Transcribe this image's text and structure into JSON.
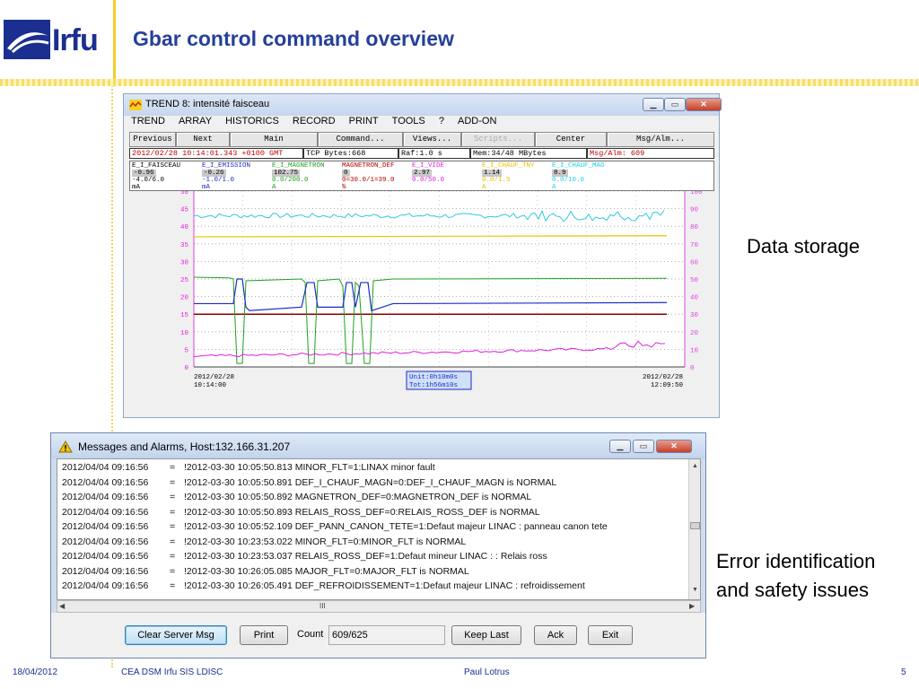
{
  "slide": {
    "title": "Gbar control command overview",
    "logo_text": "Irfu",
    "caption_data": "Data storage",
    "caption_error_line1": "Error identification",
    "caption_error_line2": "and safety issues",
    "footer_date": "18/04/2012",
    "footer_org": "CEA DSM Irfu SIS LDISC",
    "footer_author": "Paul Lotrus",
    "footer_page": "5"
  },
  "trend": {
    "title": "TREND 8: intensité faisceau",
    "menu": [
      "TREND",
      "ARRAY",
      "HISTORICS",
      "RECORD",
      "PRINT",
      "TOOLS",
      "?",
      "ADD-ON"
    ],
    "buttons": [
      "Previous",
      "Next",
      "Main",
      "Command...",
      "Views...",
      "Scripts...",
      "Center",
      "Msg/Alm..."
    ],
    "status": {
      "time": "2012/02/28 10:14:01.343 +0100 GMT",
      "tcp": "TCP Bytes:668",
      "raf": "Raf:1.0 s",
      "mem": "Mem:34/48 MBytes",
      "msg": "Msg/Alm: 609"
    },
    "params": [
      {
        "name": "E_I_FAISCEAU",
        "value": "-0.96",
        "range": "-4.0/6.0",
        "unit": "mA",
        "color": "#000000"
      },
      {
        "name": "E_I_EMISSION",
        "value": "-0.26",
        "range": "-1.0/1.0",
        "unit": "mA",
        "color": "#1a2cc8"
      },
      {
        "name": "E_I_MAGNETRON",
        "value": "102.75",
        "range": "0.0/200.0",
        "unit": "A",
        "color": "#20a020"
      },
      {
        "name": "MAGNETRON_DEF",
        "value": "0",
        "range": "0=30.0/1=39.0",
        "unit": "%",
        "color": "#b00000"
      },
      {
        "name": "E_I_VIDE",
        "value": "2.97",
        "range": "0.0/50.0",
        "unit": "",
        "color": "#e020e0"
      },
      {
        "name": "E_I_CHAUF_TNY",
        "value": "1.14",
        "range": "0.0/1.5",
        "unit": "A",
        "color": "#e8c000"
      },
      {
        "name": "E_I_CHAUF_MAG",
        "value": "8.9",
        "range": "0.0/10.0",
        "unit": "A",
        "color": "#20d0e0"
      }
    ],
    "chart": {
      "left_ticks": [
        "50",
        "45",
        "40",
        "35",
        "30",
        "25",
        "20",
        "15",
        "10",
        "5",
        "0"
      ],
      "right_ticks": [
        "100",
        "90",
        "80",
        "70",
        "60",
        "50",
        "40",
        "30",
        "20",
        "10",
        "0"
      ],
      "x_start_date": "2012/02/28",
      "x_start_time": "10:14:00",
      "x_end_date": "2012/02/28",
      "x_end_time": "12:09:50",
      "unit_label": "Unit:0h10m0s",
      "tot_label": "Tot:1h56m10s",
      "colors": {
        "red": "#8b0000",
        "yellow": "#e8c800",
        "cyan": "#30c8e0",
        "green": "#20a020",
        "navy": "#1a2cc8",
        "magenta": "#e020e0",
        "pink_axis": "#e040e0"
      }
    }
  },
  "messages": {
    "title": "Messages and Alarms, Host:132.166.31.207",
    "rows": [
      {
        "ts": "2012/04/04 09:16:56",
        "eq": "=",
        "text": "!2012-03-30 10:05:50.813 MINOR_FLT=1:LINAX minor fault"
      },
      {
        "ts": "2012/04/04 09:16:56",
        "eq": "=",
        "text": "!2012-03-30 10:05:50.891 DEF_I_CHAUF_MAGN=0:DEF_I_CHAUF_MAGN is NORMAL"
      },
      {
        "ts": "2012/04/04 09:16:56",
        "eq": "=",
        "text": "!2012-03-30 10:05:50.892 MAGNETRON_DEF=0:MAGNETRON_DEF is NORMAL"
      },
      {
        "ts": "2012/04/04 09:16:56",
        "eq": "=",
        "text": "!2012-03-30 10:05:50.893 RELAIS_ROSS_DEF=0:RELAIS_ROSS_DEF is NORMAL"
      },
      {
        "ts": "2012/04/04 09:16:56",
        "eq": "=",
        "text": "!2012-03-30 10:05:52.109 DEF_PANN_CANON_TETE=1:Defaut majeur LINAC : panneau canon tete"
      },
      {
        "ts": "2012/04/04 09:16:56",
        "eq": "=",
        "text": "!2012-03-30 10:23:53.022 MINOR_FLT=0:MINOR_FLT is NORMAL"
      },
      {
        "ts": "2012/04/04 09:16:56",
        "eq": "=",
        "text": "!2012-03-30 10:23:53.037 RELAIS_ROSS_DEF=1:Defaut mineur LINAC : : Relais ross"
      },
      {
        "ts": "2012/04/04 09:16:56",
        "eq": "=",
        "text": "!2012-03-30 10:26:05.085 MAJOR_FLT=0:MAJOR_FLT is NORMAL"
      },
      {
        "ts": "2012/04/04 09:16:56",
        "eq": "=",
        "text": "!2012-03-30 10:26:05.491 DEF_REFROIDISSEMENT=1:Defaut majeur LINAC : refroidissement"
      }
    ],
    "hscroll_grip": "III",
    "buttons": {
      "clear": "Clear Server Msg",
      "print": "Print",
      "count_label": "Count",
      "count_value": "609/625",
      "keep_last": "Keep Last",
      "ack": "Ack",
      "exit": "Exit"
    }
  }
}
